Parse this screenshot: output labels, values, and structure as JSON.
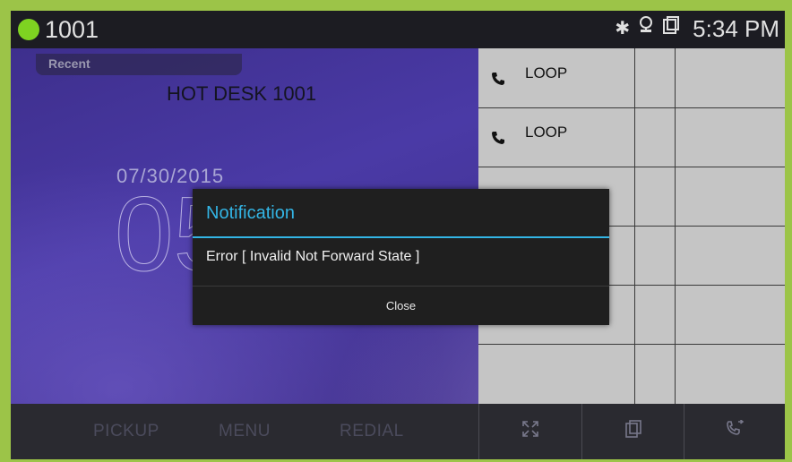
{
  "status": {
    "extension": "1001",
    "presence_color": "#7ed321",
    "icons": [
      "bluetooth-icon",
      "network-icon",
      "hotdesk-icon"
    ],
    "time": "5:34 PM"
  },
  "idle": {
    "recent_tab": "Recent",
    "title": "HOT DESK 1001",
    "date": "07/30/2015",
    "time_big": "05"
  },
  "lines": [
    {
      "icon": "phone-icon",
      "label": "LOOP"
    },
    {
      "icon": "phone-icon",
      "label": "LOOP"
    }
  ],
  "softkeys": [
    "PICKUP",
    "MENU",
    "REDIAL"
  ],
  "icon_buttons": [
    "expand-icon",
    "hotdesk-icon",
    "call-forward-icon"
  ],
  "dialog": {
    "title": "Notification",
    "message": "Error  [ Invalid Not Forward State ]",
    "close_label": "Close",
    "accent": "#33b5e5"
  }
}
